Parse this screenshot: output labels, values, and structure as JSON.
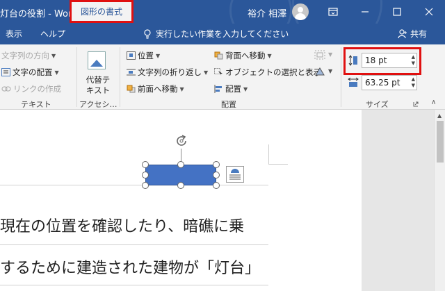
{
  "title_bar": {
    "doc_title": "灯台の役割  -  Word",
    "user_name": "裕介 相澤",
    "ribbon_display_icon": "ribbon-display-icon",
    "minimize_icon": "minimize-icon",
    "maximize_icon": "maximize-icon",
    "close_icon": "close-icon"
  },
  "tabs": {
    "items": [
      "表示",
      "ヘルプ"
    ],
    "active": "図形の書式",
    "tell_me": "実行したい作業を入力してください",
    "share": "共有"
  },
  "ribbon": {
    "text_group": {
      "label": "テキスト",
      "text_direction": "文字列の方向",
      "align_text": "文字の配置",
      "create_link": "リンクの作成"
    },
    "accessibility_group": {
      "label": "アクセシ…",
      "alt_text_line1": "代替テ",
      "alt_text_line2": "キスト"
    },
    "arrange_group": {
      "label": "配置",
      "position": "位置",
      "wrap_text": "文字列の折り返し",
      "bring_forward": "前面へ移動",
      "send_backward": "背面へ移動",
      "selection_pane": "オブジェクトの選択と表示",
      "align": "配置"
    },
    "size_group": {
      "label": "サイズ",
      "height": "18 pt",
      "width": "63.25 pt"
    }
  },
  "document": {
    "line1": "現在の位置を確認したり、暗礁に乗",
    "line2": "するために建造された建物が「灯台」"
  },
  "colors": {
    "title_bar": "#2b579a",
    "shape_fill": "#4472c4",
    "highlight": "#e01010"
  }
}
